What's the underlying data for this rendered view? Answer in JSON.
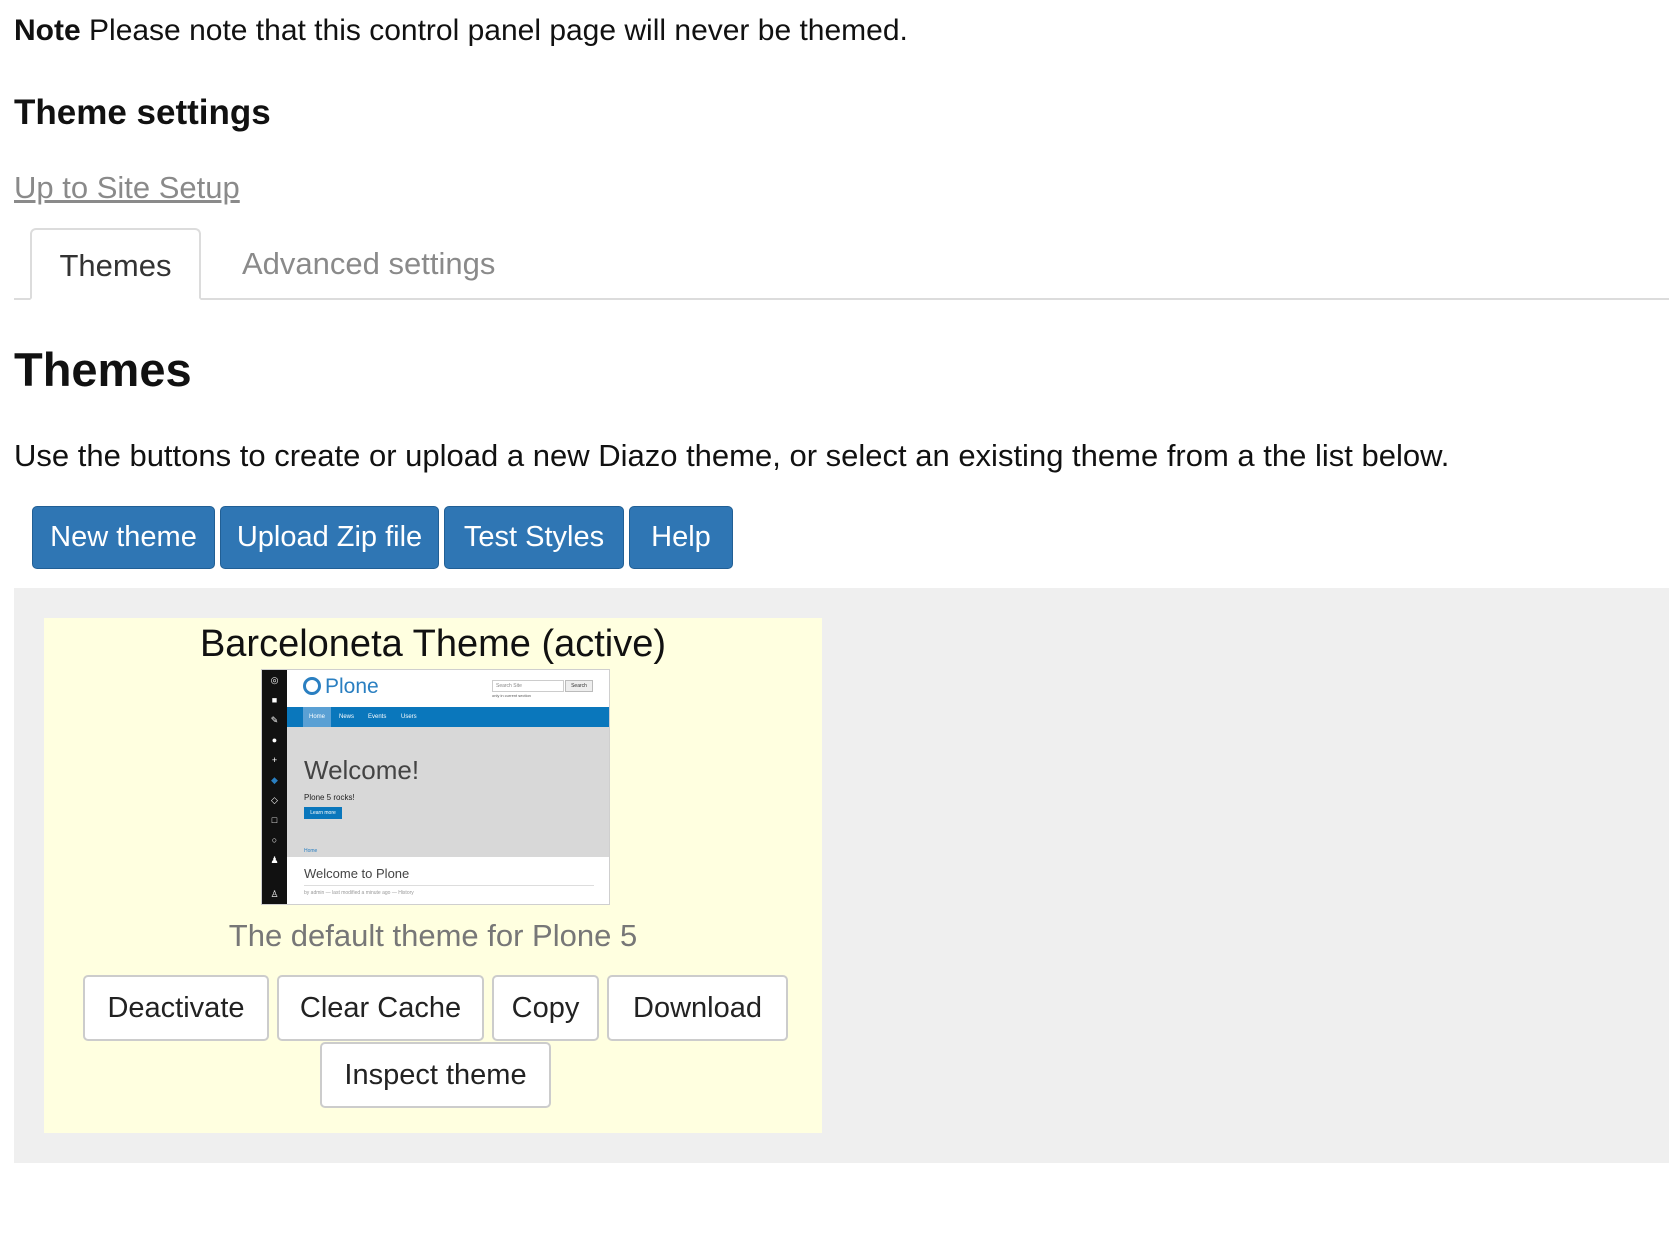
{
  "note": {
    "label": "Note",
    "text": "Please note that this control panel page will never be themed."
  },
  "settings_title": "Theme settings",
  "up_link": "Up to Site Setup",
  "tabs": [
    {
      "label": "Themes",
      "active": true
    },
    {
      "label": "Advanced settings",
      "active": false
    }
  ],
  "themes_heading": "Themes",
  "description": "Use the buttons to create or upload a new Diazo theme, or select an existing theme from a the list below.",
  "toolbar": {
    "new_theme": "New theme",
    "upload_zip": "Upload Zip file",
    "test_styles": "Test Styles",
    "help": "Help"
  },
  "theme": {
    "title": "Barceloneta Theme (active)",
    "description": "The default theme for Plone 5",
    "preview": {
      "logo": "Plone",
      "search_placeholder": "Search Site",
      "search_button": "Search",
      "search_option": "only in current section",
      "nav": [
        "Home",
        "News",
        "Events",
        "Users"
      ],
      "hero_title": "Welcome!",
      "hero_text": "Plone 5 rocks!",
      "hero_button": "Learn more",
      "breadcrumb": "Home",
      "page_title": "Welcome to Plone",
      "byline": "by admin — last modified a minute ago — History"
    },
    "actions": {
      "deactivate": "Deactivate",
      "clear_cache": "Clear Cache",
      "copy": "Copy",
      "download": "Download",
      "inspect": "Inspect theme"
    }
  },
  "colors": {
    "primary": "#2f76b4",
    "active_card": "#ffffe0",
    "panel_bg": "#efefef",
    "link": "#8a8a8a"
  }
}
